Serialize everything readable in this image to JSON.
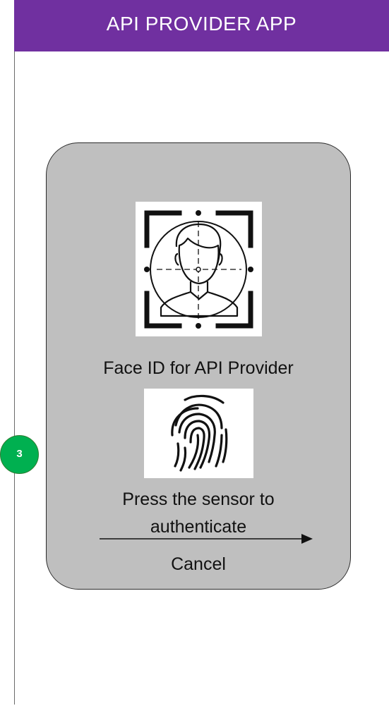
{
  "header": {
    "title": "API PROVIDER APP",
    "color": "#7030a0"
  },
  "step": {
    "number": "3",
    "color": "#00b050"
  },
  "dialog": {
    "face_id_label": "Face ID for API Provider",
    "prompt_line1": "Press the sensor to",
    "prompt_line2": "authenticate",
    "cancel_label": "Cancel",
    "background": "#bfbfbf"
  },
  "icons": {
    "face": "face-scan-icon",
    "fingerprint": "fingerprint-icon",
    "arrow": "arrow-right-icon"
  }
}
